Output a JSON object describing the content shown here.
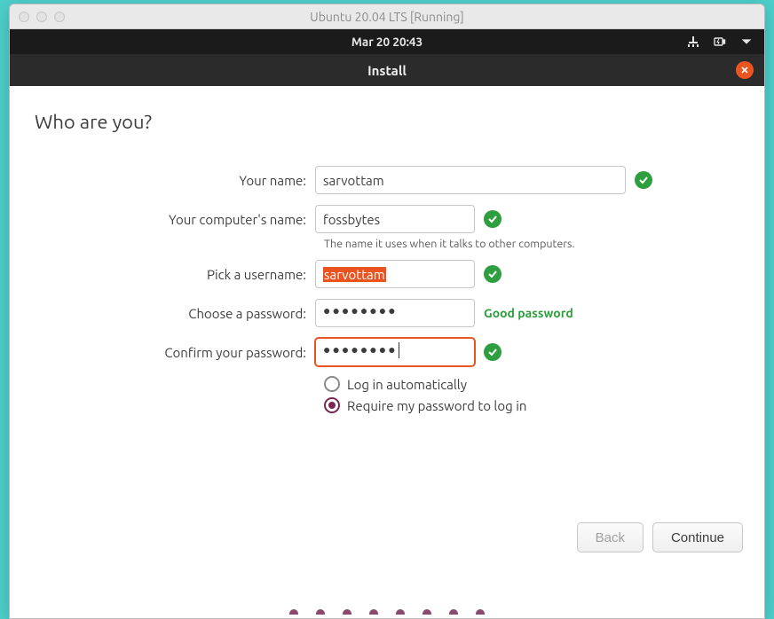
{
  "mac": {
    "title": "Ubuntu 20.04 LTS [Running]"
  },
  "gnome": {
    "datetime": "Mar 20  20:43"
  },
  "installer": {
    "window_title": "Install",
    "heading": "Who are you?",
    "labels": {
      "name": "Your name:",
      "hostname": "Your computer's name:",
      "hostname_hint": "The name it uses when it talks to other computers.",
      "username": "Pick a username:",
      "password": "Choose a password:",
      "confirm": "Confirm your password:"
    },
    "values": {
      "name": "sarvottam",
      "hostname": "fossbytes",
      "username": "sarvottam",
      "password_mask": "●●●●●●●●",
      "confirm_mask": "●●●●●●●●"
    },
    "password_strength": "Good password",
    "radio": {
      "auto": "Log in automatically",
      "require": "Require my password to log in",
      "selected": "require"
    },
    "buttons": {
      "back": "Back",
      "continue": "Continue"
    }
  }
}
